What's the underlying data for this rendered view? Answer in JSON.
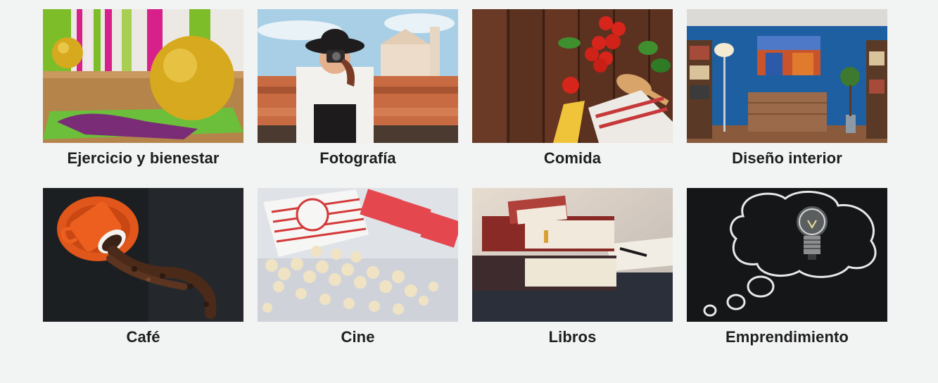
{
  "categories": [
    {
      "label": "Ejercicio y bienestar",
      "image": "exercise-balls-photo"
    },
    {
      "label": "Fotografía",
      "image": "photographer-woman-photo"
    },
    {
      "label": "Comida",
      "image": "tomatoes-pasta-photo"
    },
    {
      "label": "Diseño interior",
      "image": "living-room-photo"
    },
    {
      "label": "Café",
      "image": "coffee-cup-beans-photo"
    },
    {
      "label": "Cine",
      "image": "popcorn-tickets-photo"
    },
    {
      "label": "Libros",
      "image": "books-stack-photo"
    },
    {
      "label": "Emprendimiento",
      "image": "lightbulb-chalk-photo"
    }
  ]
}
